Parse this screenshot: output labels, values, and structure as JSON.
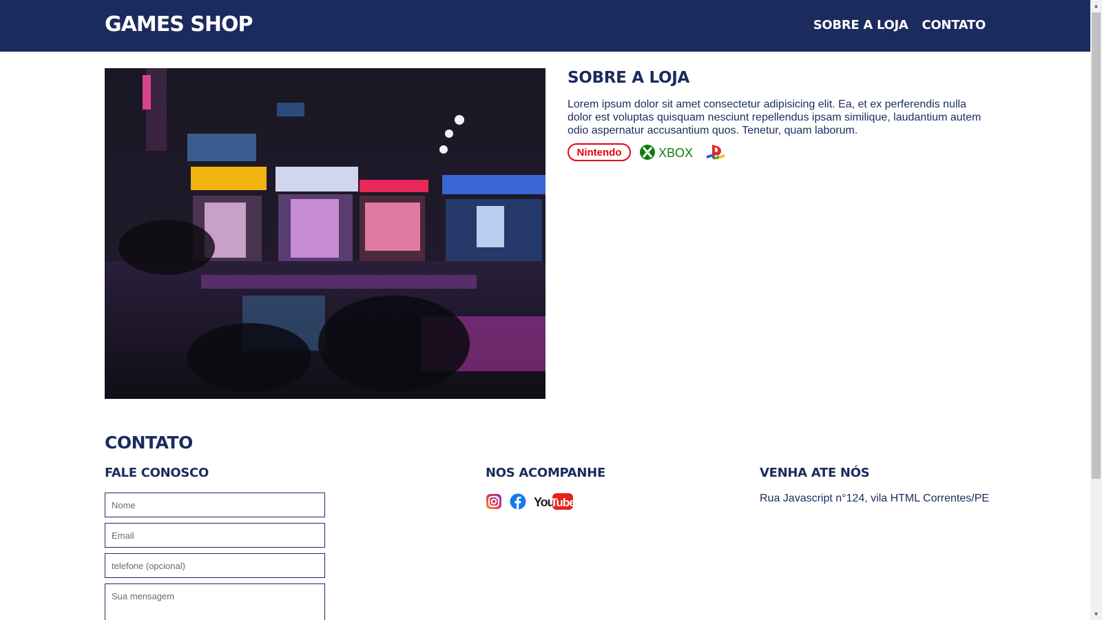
{
  "header": {
    "logo": "GAMES SHOP",
    "nav": [
      "SOBRE A LOJA",
      "CONTATO"
    ]
  },
  "about": {
    "title": "SOBRE A LOJA",
    "text": "Lorem ipsum dolor sit amet consectetur adipisicing elit. Ea, et ex perferendis nulla dolor est voluptas quisquam nesciunt repellendus ipsam similique, laudantium autem odio aspernatur accusantium quos. Tenetur, quam laborum.",
    "brands": {
      "nintendo": "Nintendo",
      "xbox": "XBOX",
      "playstation_icon": "playstation-logo"
    }
  },
  "contact": {
    "title": "CONTATO",
    "form": {
      "heading": "FALE CONOSCO",
      "name_placeholder": "Nome",
      "email_placeholder": "Email",
      "phone_placeholder": "telefone (opcional)",
      "message_placeholder": "Sua mensagem"
    },
    "social": {
      "heading": "NOS ACOMPANHE",
      "icons": [
        "instagram-icon",
        "facebook-icon",
        "youtube-logo"
      ],
      "youtube_text_you": "You",
      "youtube_text_tube": "Tube"
    },
    "location": {
      "heading": "VENHA ATE NÓS",
      "address": "Rua Javascript n°124, vila HTML Correntes/PE"
    }
  },
  "colors": {
    "primary": "#1b2b5e",
    "background": "#ffffff"
  }
}
